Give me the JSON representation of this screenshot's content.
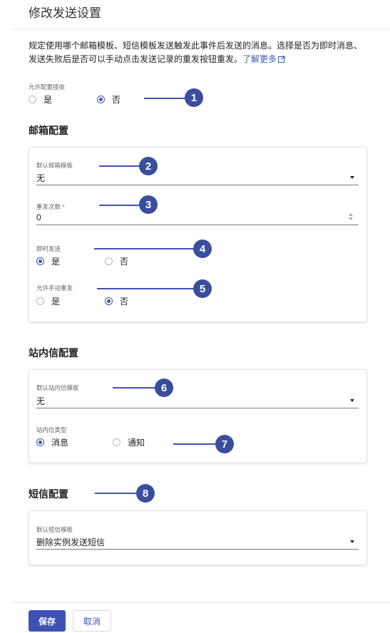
{
  "page": {
    "title": "修改发送设置",
    "description": "规定使用哪个邮箱模板、短信模板发送触发此事件后发送的消息。选择是否为即时消息、发送失败后是否可以手动点击发送记录的重发按钮重发。",
    "learn_more": "了解更多"
  },
  "allow_receive": {
    "label": "允许配置接收",
    "options": [
      "是",
      "否"
    ],
    "selected": "否"
  },
  "email": {
    "section_title": "邮箱配置",
    "template_label": "默认邮箱模板",
    "template_value": "无",
    "retry_label": "重发次数",
    "retry_required_mark": "*",
    "retry_value": "0",
    "instant_label": "即时发送",
    "instant_options": [
      "是",
      "否"
    ],
    "instant_selected": "是",
    "manual_label": "允许手动重发",
    "manual_options": [
      "是",
      "否"
    ],
    "manual_selected": "否"
  },
  "site_message": {
    "section_title": "站内信配置",
    "template_label": "默认站内信模板",
    "template_value": "无",
    "type_label": "站内信类型",
    "type_options": [
      "消息",
      "通知"
    ],
    "type_selected": "消息"
  },
  "sms": {
    "section_title": "短信配置",
    "template_label": "默认短信模板",
    "template_value": "删除实例发送短信"
  },
  "callouts": [
    "1",
    "2",
    "3",
    "4",
    "5",
    "6",
    "7",
    "8"
  ],
  "actions": {
    "save": "保存",
    "cancel": "取消"
  },
  "colors": {
    "accent": "#3f51b5",
    "badge": "#3a4e9e",
    "link": "#3b5bb5"
  }
}
